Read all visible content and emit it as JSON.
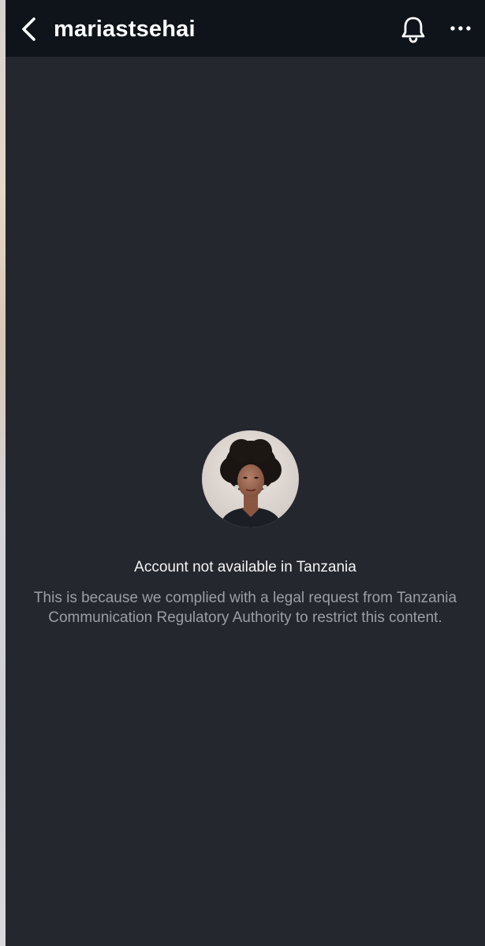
{
  "header": {
    "title": "mariastsehai",
    "back_icon": "chevron-left-icon",
    "bell_icon": "bell-icon",
    "more_icon": "more-horizontal-icon"
  },
  "notice": {
    "heading": "Account not available in Tanzania",
    "description": "This is because we complied with a legal request from Tanzania Communication Regulatory Authority to restrict this content."
  },
  "colors": {
    "background": "#25272f",
    "header_background": "#0f141b",
    "primary_text": "#f4f4f5",
    "secondary_text": "#9b9ea6"
  }
}
